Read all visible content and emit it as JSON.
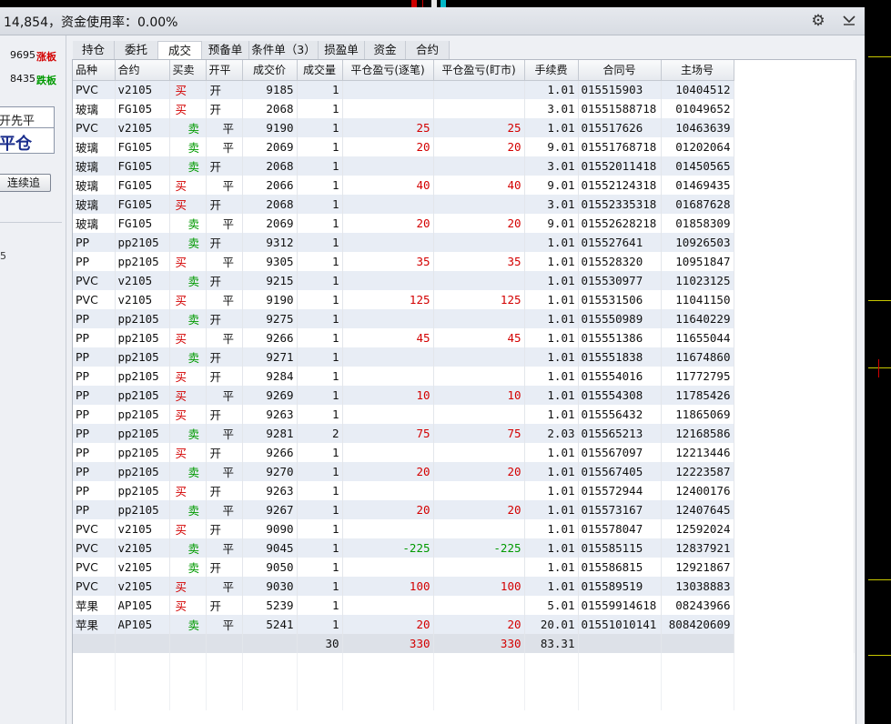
{
  "title_bar": {
    "text": "14,854，资金使用率：0.00%",
    "icons": [
      "gear-icon",
      "chevron-down-icon"
    ]
  },
  "left_panel": {
    "limit_up": {
      "price": "9695",
      "tag": "涨板"
    },
    "limit_down": {
      "price": "8435",
      "tag": "跌板"
    },
    "close_mode": {
      "line1": "开先平",
      "line2": "平仓"
    },
    "chase_button": "连续追",
    "side_mark": "5"
  },
  "tabs": [
    "持仓",
    "委托",
    "成交",
    "预备单",
    "条件单（3）",
    "损盈单",
    "资金",
    "合约"
  ],
  "active_tab": 2,
  "columns": [
    "品种",
    "合约",
    "买卖",
    "开平",
    "成交价",
    "成交量",
    "平仓盈亏(逐笔)",
    "平仓盈亏(盯市)",
    "手续费",
    "合同号",
    "主场号"
  ],
  "rows": [
    {
      "product": "PVC",
      "contract": "v2105",
      "side": "买",
      "oc": "开",
      "price": "9185",
      "qty": "1",
      "pnl_trade": "",
      "pnl_mark": "",
      "fee": "1.01",
      "order_no": "015515903",
      "exch_no": "10404512"
    },
    {
      "product": "玻璃",
      "contract": "FG105",
      "side": "买",
      "oc": "开",
      "price": "2068",
      "qty": "1",
      "pnl_trade": "",
      "pnl_mark": "",
      "fee": "3.01",
      "order_no": "01551588718",
      "exch_no": "01049652"
    },
    {
      "product": "PVC",
      "contract": "v2105",
      "side": "卖",
      "oc": "平",
      "price": "9190",
      "qty": "1",
      "pnl_trade": "25",
      "pnl_mark": "25",
      "fee": "1.01",
      "order_no": "015517626",
      "exch_no": "10463639"
    },
    {
      "product": "玻璃",
      "contract": "FG105",
      "side": "卖",
      "oc": "平",
      "price": "2069",
      "qty": "1",
      "pnl_trade": "20",
      "pnl_mark": "20",
      "fee": "9.01",
      "order_no": "01551768718",
      "exch_no": "01202064"
    },
    {
      "product": "玻璃",
      "contract": "FG105",
      "side": "卖",
      "oc": "开",
      "price": "2068",
      "qty": "1",
      "pnl_trade": "",
      "pnl_mark": "",
      "fee": "3.01",
      "order_no": "01552011418",
      "exch_no": "01450565"
    },
    {
      "product": "玻璃",
      "contract": "FG105",
      "side": "买",
      "oc": "平",
      "price": "2066",
      "qty": "1",
      "pnl_trade": "40",
      "pnl_mark": "40",
      "fee": "9.01",
      "order_no": "01552124318",
      "exch_no": "01469435"
    },
    {
      "product": "玻璃",
      "contract": "FG105",
      "side": "买",
      "oc": "开",
      "price": "2068",
      "qty": "1",
      "pnl_trade": "",
      "pnl_mark": "",
      "fee": "3.01",
      "order_no": "01552335318",
      "exch_no": "01687628"
    },
    {
      "product": "玻璃",
      "contract": "FG105",
      "side": "卖",
      "oc": "平",
      "price": "2069",
      "qty": "1",
      "pnl_trade": "20",
      "pnl_mark": "20",
      "fee": "9.01",
      "order_no": "01552628218",
      "exch_no": "01858309"
    },
    {
      "product": "PP",
      "contract": "pp2105",
      "side": "卖",
      "oc": "开",
      "price": "9312",
      "qty": "1",
      "pnl_trade": "",
      "pnl_mark": "",
      "fee": "1.01",
      "order_no": "015527641",
      "exch_no": "10926503"
    },
    {
      "product": "PP",
      "contract": "pp2105",
      "side": "买",
      "oc": "平",
      "price": "9305",
      "qty": "1",
      "pnl_trade": "35",
      "pnl_mark": "35",
      "fee": "1.01",
      "order_no": "015528320",
      "exch_no": "10951847"
    },
    {
      "product": "PVC",
      "contract": "v2105",
      "side": "卖",
      "oc": "开",
      "price": "9215",
      "qty": "1",
      "pnl_trade": "",
      "pnl_mark": "",
      "fee": "1.01",
      "order_no": "015530977",
      "exch_no": "11023125"
    },
    {
      "product": "PVC",
      "contract": "v2105",
      "side": "买",
      "oc": "平",
      "price": "9190",
      "qty": "1",
      "pnl_trade": "125",
      "pnl_mark": "125",
      "fee": "1.01",
      "order_no": "015531506",
      "exch_no": "11041150"
    },
    {
      "product": "PP",
      "contract": "pp2105",
      "side": "卖",
      "oc": "开",
      "price": "9275",
      "qty": "1",
      "pnl_trade": "",
      "pnl_mark": "",
      "fee": "1.01",
      "order_no": "015550989",
      "exch_no": "11640229"
    },
    {
      "product": "PP",
      "contract": "pp2105",
      "side": "买",
      "oc": "平",
      "price": "9266",
      "qty": "1",
      "pnl_trade": "45",
      "pnl_mark": "45",
      "fee": "1.01",
      "order_no": "015551386",
      "exch_no": "11655044"
    },
    {
      "product": "PP",
      "contract": "pp2105",
      "side": "卖",
      "oc": "开",
      "price": "9271",
      "qty": "1",
      "pnl_trade": "",
      "pnl_mark": "",
      "fee": "1.01",
      "order_no": "015551838",
      "exch_no": "11674860"
    },
    {
      "product": "PP",
      "contract": "pp2105",
      "side": "买",
      "oc": "开",
      "price": "9284",
      "qty": "1",
      "pnl_trade": "",
      "pnl_mark": "",
      "fee": "1.01",
      "order_no": "015554016",
      "exch_no": "11772795"
    },
    {
      "product": "PP",
      "contract": "pp2105",
      "side": "买",
      "oc": "平",
      "price": "9269",
      "qty": "1",
      "pnl_trade": "10",
      "pnl_mark": "10",
      "fee": "1.01",
      "order_no": "015554308",
      "exch_no": "11785426"
    },
    {
      "product": "PP",
      "contract": "pp2105",
      "side": "买",
      "oc": "开",
      "price": "9263",
      "qty": "1",
      "pnl_trade": "",
      "pnl_mark": "",
      "fee": "1.01",
      "order_no": "015556432",
      "exch_no": "11865069"
    },
    {
      "product": "PP",
      "contract": "pp2105",
      "side": "卖",
      "oc": "平",
      "price": "9281",
      "qty": "2",
      "pnl_trade": "75",
      "pnl_mark": "75",
      "fee": "2.03",
      "order_no": "015565213",
      "exch_no": "12168586"
    },
    {
      "product": "PP",
      "contract": "pp2105",
      "side": "买",
      "oc": "开",
      "price": "9266",
      "qty": "1",
      "pnl_trade": "",
      "pnl_mark": "",
      "fee": "1.01",
      "order_no": "015567097",
      "exch_no": "12213446"
    },
    {
      "product": "PP",
      "contract": "pp2105",
      "side": "卖",
      "oc": "平",
      "price": "9270",
      "qty": "1",
      "pnl_trade": "20",
      "pnl_mark": "20",
      "fee": "1.01",
      "order_no": "015567405",
      "exch_no": "12223587"
    },
    {
      "product": "PP",
      "contract": "pp2105",
      "side": "买",
      "oc": "开",
      "price": "9263",
      "qty": "1",
      "pnl_trade": "",
      "pnl_mark": "",
      "fee": "1.01",
      "order_no": "015572944",
      "exch_no": "12400176"
    },
    {
      "product": "PP",
      "contract": "pp2105",
      "side": "卖",
      "oc": "平",
      "price": "9267",
      "qty": "1",
      "pnl_trade": "20",
      "pnl_mark": "20",
      "fee": "1.01",
      "order_no": "015573167",
      "exch_no": "12407645"
    },
    {
      "product": "PVC",
      "contract": "v2105",
      "side": "买",
      "oc": "开",
      "price": "9090",
      "qty": "1",
      "pnl_trade": "",
      "pnl_mark": "",
      "fee": "1.01",
      "order_no": "015578047",
      "exch_no": "12592024"
    },
    {
      "product": "PVC",
      "contract": "v2105",
      "side": "卖",
      "oc": "平",
      "price": "9045",
      "qty": "1",
      "pnl_trade": "-225",
      "pnl_mark": "-225",
      "fee": "1.01",
      "order_no": "015585115",
      "exch_no": "12837921"
    },
    {
      "product": "PVC",
      "contract": "v2105",
      "side": "卖",
      "oc": "开",
      "price": "9050",
      "qty": "1",
      "pnl_trade": "",
      "pnl_mark": "",
      "fee": "1.01",
      "order_no": "015586815",
      "exch_no": "12921867"
    },
    {
      "product": "PVC",
      "contract": "v2105",
      "side": "买",
      "oc": "平",
      "price": "9030",
      "qty": "1",
      "pnl_trade": "100",
      "pnl_mark": "100",
      "fee": "1.01",
      "order_no": "015589519",
      "exch_no": "13038883"
    },
    {
      "product": "苹果",
      "contract": "AP105",
      "side": "买",
      "oc": "开",
      "price": "5239",
      "qty": "1",
      "pnl_trade": "",
      "pnl_mark": "",
      "fee": "5.01",
      "order_no": "01559914618",
      "exch_no": "08243966"
    },
    {
      "product": "苹果",
      "contract": "AP105",
      "side": "卖",
      "oc": "平",
      "price": "5241",
      "qty": "1",
      "pnl_trade": "20",
      "pnl_mark": "20",
      "fee": "20.01",
      "order_no": "01551010141",
      "exch_no": "808420609"
    }
  ],
  "totals": {
    "qty": "30",
    "pnl_trade": "330",
    "pnl_mark": "330",
    "fee": "83.31"
  },
  "colors": {
    "buy": "#d30000",
    "sell": "#009a00",
    "row_alt": "#e8edf5",
    "accent": "#1a2d8c"
  }
}
